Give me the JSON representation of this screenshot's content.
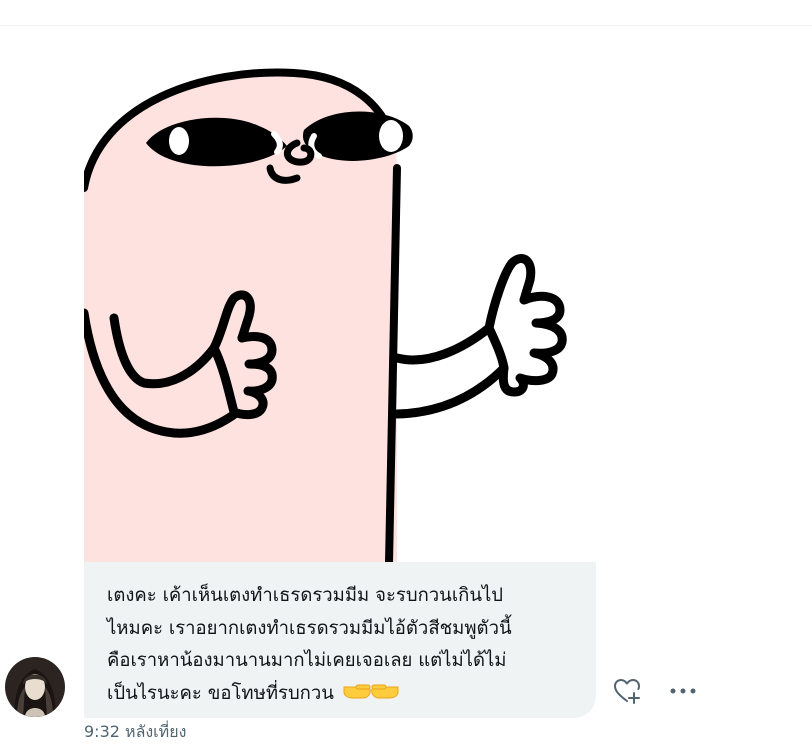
{
  "message": {
    "text": "เตงคะ เค้าเห็นเตงทำเธรดรวมมีม จะรบกวนเกินไป\nไหมคะ เราอยากเตงทำเธรดรวมมีมไอ้ตัวสีชมพูตัวนี้\nคือเราหาน้องมานานมากไม่เคยเจอเลย แต่ไม่ได้ไม่\nเป็นไรนะคะ ขอโทษที่รบกวน",
    "emoji_icon": "pointing-hands-emoji-icon",
    "timestamp": "9:32 หลังเที่ยง"
  },
  "sticker": {
    "icon": "pink-thumbs-up-meme-sticker",
    "color": "#fde2e0"
  },
  "actions": {
    "react_icon": "add-reaction-heart-icon",
    "more_icon": "more-options-icon"
  },
  "colors": {
    "bubble": "#eff3f4",
    "text": "#0f1419",
    "muted": "#536471"
  }
}
